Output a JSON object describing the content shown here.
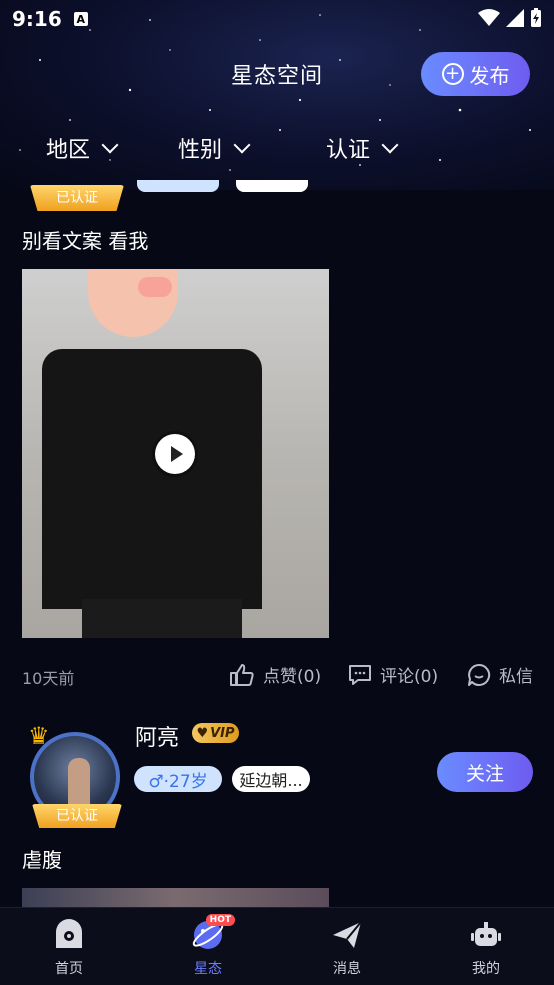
{
  "status_bar": {
    "time": "9:16",
    "a_badge": "A"
  },
  "header": {
    "title": "星态空间",
    "publish_label": "发布",
    "publish_icon": "plus-circle-icon"
  },
  "filters": [
    {
      "label": "地区"
    },
    {
      "label": "性别"
    },
    {
      "label": "认证"
    }
  ],
  "post1": {
    "verified_label": "已认证",
    "text": "别看文案 看我",
    "time_ago": "10天前",
    "like_label": "点赞(0)",
    "comment_label": "评论(0)",
    "message_label": "私信"
  },
  "post2": {
    "username": "阿亮",
    "vip_label": "VIP",
    "age_label": "♂·27岁",
    "location_label": "延边朝...",
    "verified_label": "已认证",
    "follow_label": "关注",
    "text": "虐腹"
  },
  "tabbar": {
    "items": [
      {
        "label": "首页",
        "icon": "ghost-icon",
        "active": false
      },
      {
        "label": "星态",
        "icon": "planet-icon",
        "active": true,
        "hot": "HOT"
      },
      {
        "label": "消息",
        "icon": "paper-plane-icon",
        "active": false
      },
      {
        "label": "我的",
        "icon": "robot-icon",
        "active": false
      }
    ]
  },
  "colors": {
    "accent": "#6b7cff",
    "background": "#060816",
    "gold": "#f0a020"
  }
}
